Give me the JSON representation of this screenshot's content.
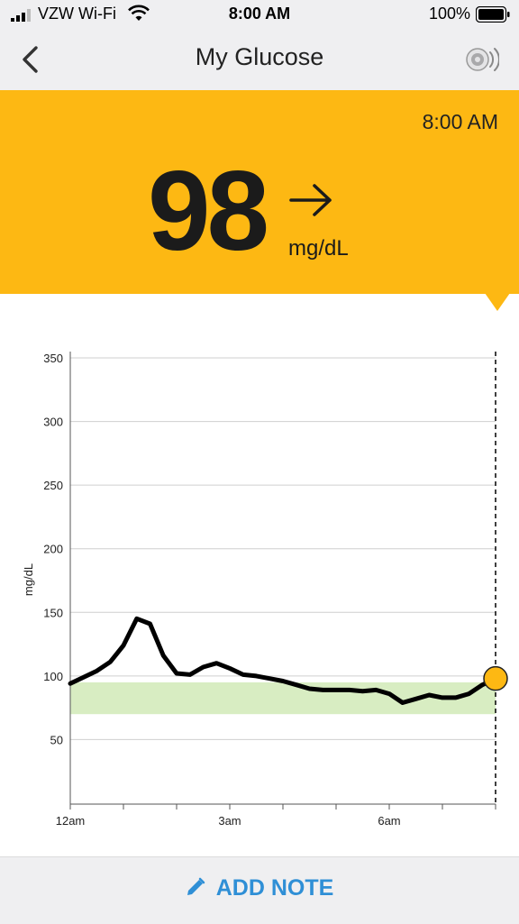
{
  "status_bar": {
    "carrier": "VZW Wi-Fi",
    "time": "8:00 AM",
    "battery": "100%"
  },
  "nav": {
    "title": "My Glucose",
    "back_icon": "chevron-left-icon",
    "sensor_icon": "sensor-scan-icon"
  },
  "reading": {
    "time": "8:00 AM",
    "value": "98",
    "unit": "mg/dL",
    "trend": "steady",
    "trend_icon": "arrow-right-icon",
    "panel_color": "#fdb813"
  },
  "chart_data": {
    "type": "line",
    "ylabel": "mg/dL",
    "xlabel": "",
    "ylim": [
      0,
      350
    ],
    "y_ticks": [
      50,
      100,
      150,
      200,
      250,
      300,
      350
    ],
    "x_range_hours": [
      0,
      8
    ],
    "x_ticks": [
      {
        "hour": 0,
        "label": "12am"
      },
      {
        "hour": 3,
        "label": "3am"
      },
      {
        "hour": 6,
        "label": "6am"
      }
    ],
    "target_range": [
      70,
      95
    ],
    "target_color": "#d8edc2",
    "series": [
      {
        "color": "#000000",
        "x": [
          0,
          0.25,
          0.5,
          0.75,
          1.0,
          1.25,
          1.5,
          1.75,
          2.0,
          2.25,
          2.5,
          2.75,
          3.0,
          3.25,
          3.5,
          3.75,
          4.0,
          4.25,
          4.5,
          4.75,
          5.0,
          5.25,
          5.5,
          5.75,
          6.0,
          6.25,
          6.5,
          6.75,
          7.0,
          7.25,
          7.5,
          7.75,
          8.0
        ],
        "values": [
          94,
          99,
          104,
          111,
          124,
          145,
          141,
          116,
          102,
          101,
          107,
          110,
          106,
          101,
          100,
          98,
          96,
          93,
          90,
          89,
          89,
          89,
          88,
          89,
          86,
          79,
          82,
          85,
          83,
          83,
          86,
          93,
          98
        ]
      }
    ],
    "current": {
      "hour": 8,
      "value": 98,
      "color": "#fdb813"
    }
  },
  "footer": {
    "add_note_label": "ADD NOTE",
    "pencil_icon": "pencil-icon",
    "accent": "#2f8fd6"
  }
}
